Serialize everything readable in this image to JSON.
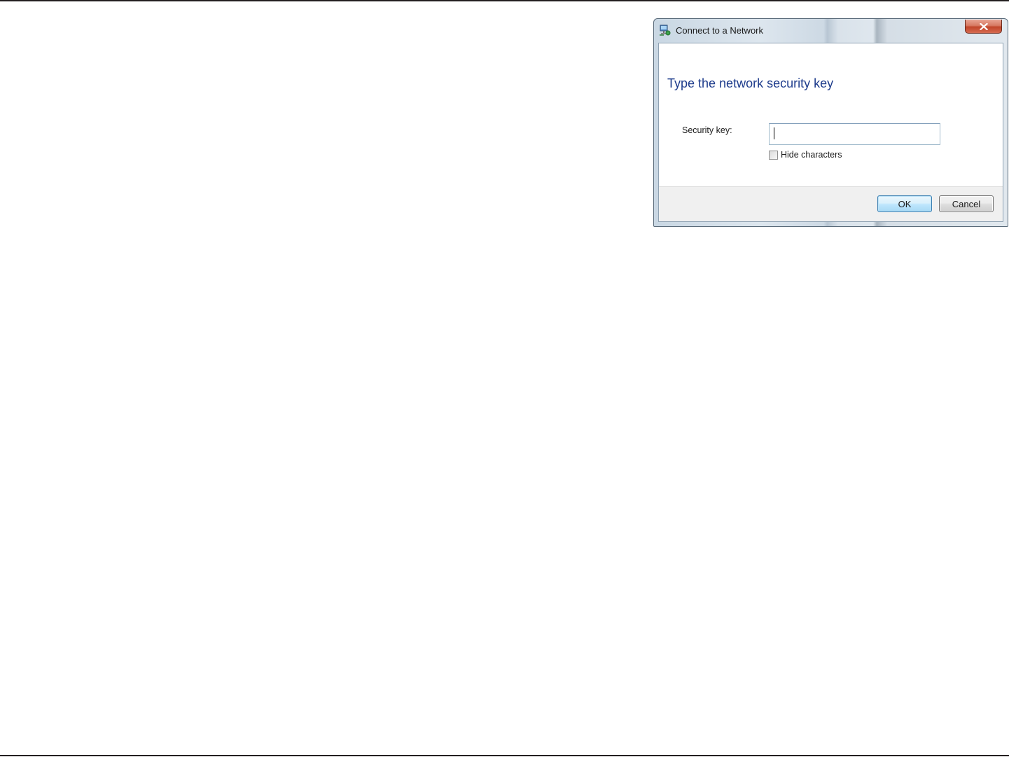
{
  "window": {
    "title": "Connect to a Network",
    "close_label": "x"
  },
  "dialog": {
    "heading": "Type the network security key",
    "security_key_label": "Security key:",
    "security_key_value": "",
    "hide_characters_label": "Hide characters",
    "hide_characters_checked": false,
    "ok_label": "OK",
    "cancel_label": "Cancel"
  },
  "icons": {
    "title_icon": "network-icon",
    "close_icon": "close-icon"
  },
  "colors": {
    "heading": "#1e3c8c",
    "close_button": "#c1452a",
    "default_button_border": "#3c7fb1"
  }
}
